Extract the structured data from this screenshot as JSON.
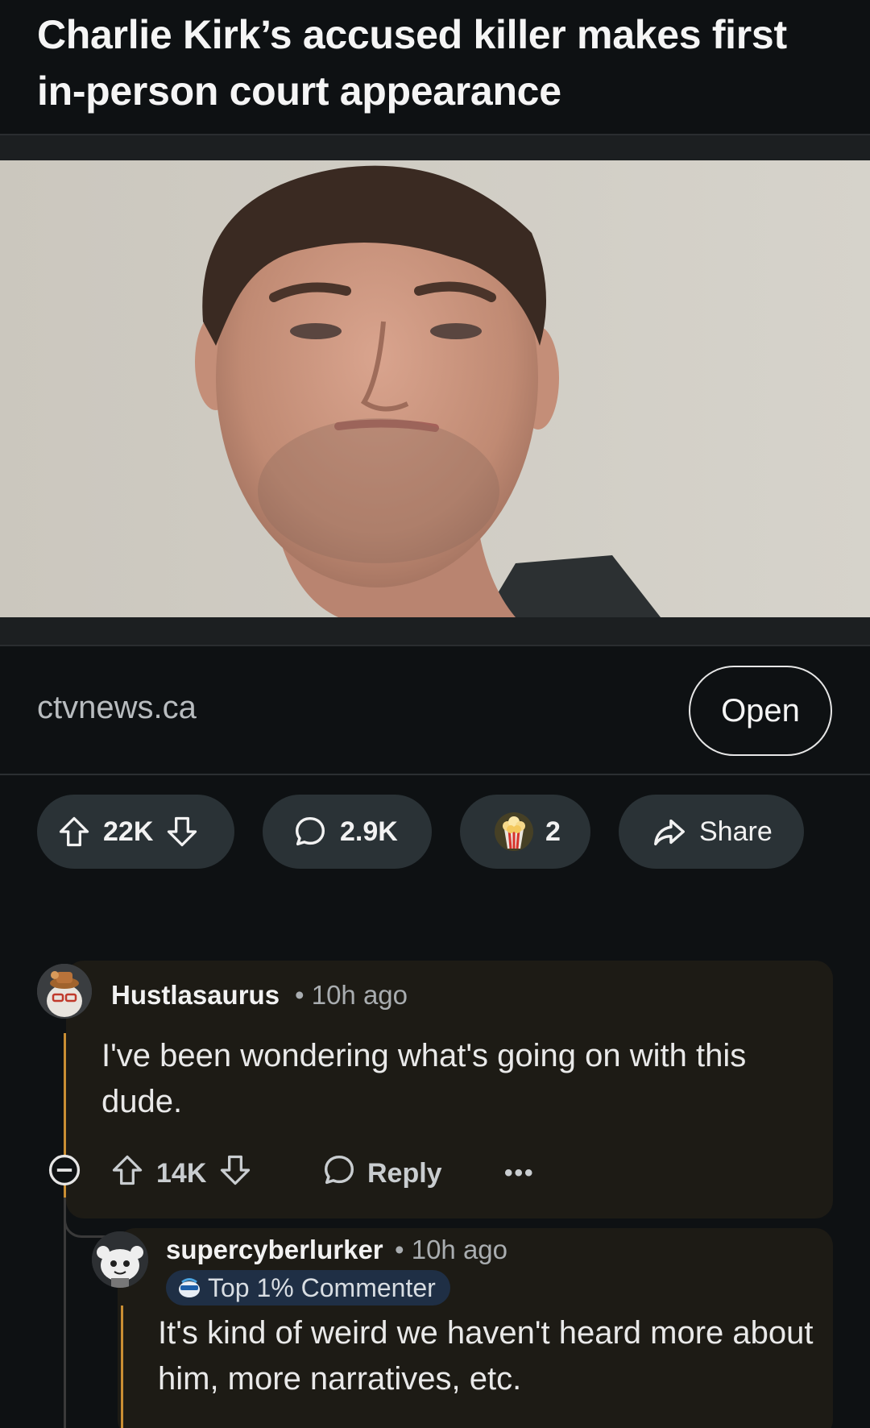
{
  "post": {
    "title": "Charlie Kirk’s accused killer makes first in-person court appearance",
    "link_domain": "ctvnews.ca",
    "open_label": "Open",
    "upvotes": "22K",
    "comments": "2.9K",
    "awards": "2",
    "share_label": "Share"
  },
  "comments": [
    {
      "username": "Hustlasaurus",
      "time": "• 10h ago",
      "body": "I've been wondering what's going on with this dude.",
      "upvotes": "14K",
      "reply_label": "Reply",
      "more_label": "•••"
    },
    {
      "username": "supercyberlurker",
      "time": "• 10h ago",
      "flair": "Top 1% Commenter",
      "body": "It's kind of weird we haven't heard more about him, more narratives, etc."
    }
  ],
  "colors": {
    "background": "#0e1113",
    "pill": "#2a3236",
    "comment_card": "#1d1b15",
    "thread_accent": "#c98e33",
    "flair_bg": "#1f2f45"
  }
}
